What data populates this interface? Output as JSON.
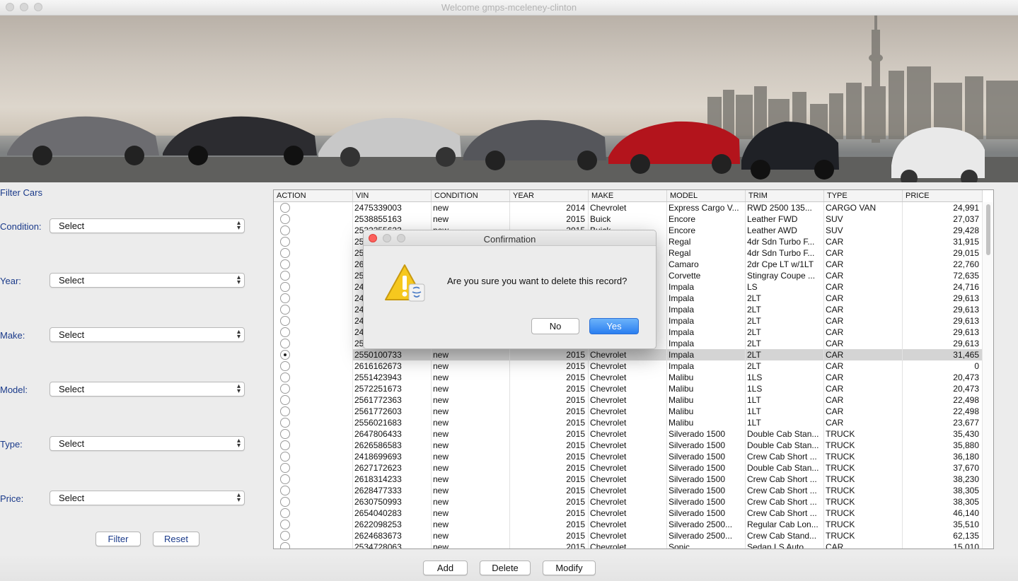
{
  "window": {
    "title": "Welcome gmps-mceleney-clinton"
  },
  "filter": {
    "title": "Filter Cars",
    "fields": [
      {
        "label": "Condition:",
        "value": "Select"
      },
      {
        "label": "Year:",
        "value": "Select"
      },
      {
        "label": "Make:",
        "value": "Select"
      },
      {
        "label": "Model:",
        "value": "Select"
      },
      {
        "label": "Type:",
        "value": "Select"
      },
      {
        "label": "Price:",
        "value": "Select"
      }
    ],
    "filter_button": "Filter",
    "reset_button": "Reset"
  },
  "table": {
    "columns": [
      "ACTION",
      "VIN",
      "CONDITION",
      "YEAR",
      "MAKE",
      "MODEL",
      "TRIM",
      "TYPE",
      "PRICE"
    ],
    "rows": [
      {
        "vin": "2475339003",
        "condition": "new",
        "year": "2014",
        "make": "Chevrolet",
        "model": "Express Cargo V...",
        "trim": "RWD 2500 135...",
        "type": "CARGO VAN",
        "price": "24,991",
        "selected": false
      },
      {
        "vin": "2538855163",
        "condition": "new",
        "year": "2015",
        "make": "Buick",
        "model": "Encore",
        "trim": "Leather FWD",
        "type": "SUV",
        "price": "27,037",
        "selected": false
      },
      {
        "vin": "2532355623",
        "condition": "new",
        "year": "2015",
        "make": "Buick",
        "model": "Encore",
        "trim": "Leather AWD",
        "type": "SUV",
        "price": "29,428",
        "selected": false
      },
      {
        "vin": "25",
        "condition": "",
        "year": "",
        "make": "",
        "model": "Regal",
        "trim": "4dr Sdn Turbo F...",
        "type": "CAR",
        "price": "31,915",
        "selected": false
      },
      {
        "vin": "25",
        "condition": "",
        "year": "",
        "make": "",
        "model": "Regal",
        "trim": "4dr Sdn Turbo F...",
        "type": "CAR",
        "price": "29,015",
        "selected": false
      },
      {
        "vin": "26",
        "condition": "",
        "year": "",
        "make": "",
        "model": "Camaro",
        "trim": "2dr Cpe LT w/1LT",
        "type": "CAR",
        "price": "22,760",
        "selected": false
      },
      {
        "vin": "25",
        "condition": "",
        "year": "",
        "make": "",
        "model": "Corvette",
        "trim": "Stingray Coupe ...",
        "type": "CAR",
        "price": "72,635",
        "selected": false
      },
      {
        "vin": "24",
        "condition": "",
        "year": "",
        "make": "",
        "model": "Impala",
        "trim": "LS",
        "type": "CAR",
        "price": "24,716",
        "selected": false
      },
      {
        "vin": "24",
        "condition": "",
        "year": "",
        "make": "",
        "model": "Impala",
        "trim": "2LT",
        "type": "CAR",
        "price": "29,613",
        "selected": false
      },
      {
        "vin": "24",
        "condition": "",
        "year": "",
        "make": "",
        "model": "Impala",
        "trim": "2LT",
        "type": "CAR",
        "price": "29,613",
        "selected": false
      },
      {
        "vin": "24",
        "condition": "",
        "year": "",
        "make": "",
        "model": "Impala",
        "trim": "2LT",
        "type": "CAR",
        "price": "29,613",
        "selected": false
      },
      {
        "vin": "24",
        "condition": "",
        "year": "",
        "make": "",
        "model": "Impala",
        "trim": "2LT",
        "type": "CAR",
        "price": "29,613",
        "selected": false
      },
      {
        "vin": "25",
        "condition": "",
        "year": "",
        "make": "",
        "model": "Impala",
        "trim": "2LT",
        "type": "CAR",
        "price": "29,613",
        "selected": false
      },
      {
        "vin": "2550100733",
        "condition": "new",
        "year": "2015",
        "make": "Chevrolet",
        "model": "Impala",
        "trim": "2LT",
        "type": "CAR",
        "price": "31,465",
        "selected": true
      },
      {
        "vin": "2616162673",
        "condition": "new",
        "year": "2015",
        "make": "Chevrolet",
        "model": "Impala",
        "trim": "2LT",
        "type": "CAR",
        "price": "0",
        "selected": false
      },
      {
        "vin": "2551423943",
        "condition": "new",
        "year": "2015",
        "make": "Chevrolet",
        "model": "Malibu",
        "trim": "1LS",
        "type": "CAR",
        "price": "20,473",
        "selected": false
      },
      {
        "vin": "2572251673",
        "condition": "new",
        "year": "2015",
        "make": "Chevrolet",
        "model": "Malibu",
        "trim": "1LS",
        "type": "CAR",
        "price": "20,473",
        "selected": false
      },
      {
        "vin": "2561772363",
        "condition": "new",
        "year": "2015",
        "make": "Chevrolet",
        "model": "Malibu",
        "trim": "1LT",
        "type": "CAR",
        "price": "22,498",
        "selected": false
      },
      {
        "vin": "2561772603",
        "condition": "new",
        "year": "2015",
        "make": "Chevrolet",
        "model": "Malibu",
        "trim": "1LT",
        "type": "CAR",
        "price": "22,498",
        "selected": false
      },
      {
        "vin": "2556021683",
        "condition": "new",
        "year": "2015",
        "make": "Chevrolet",
        "model": "Malibu",
        "trim": "1LT",
        "type": "CAR",
        "price": "23,677",
        "selected": false
      },
      {
        "vin": "2647806433",
        "condition": "new",
        "year": "2015",
        "make": "Chevrolet",
        "model": "Silverado 1500",
        "trim": "Double Cab Stan...",
        "type": "TRUCK",
        "price": "35,430",
        "selected": false
      },
      {
        "vin": "2626586583",
        "condition": "new",
        "year": "2015",
        "make": "Chevrolet",
        "model": "Silverado 1500",
        "trim": "Double Cab Stan...",
        "type": "TRUCK",
        "price": "35,880",
        "selected": false
      },
      {
        "vin": "2418699693",
        "condition": "new",
        "year": "2015",
        "make": "Chevrolet",
        "model": "Silverado 1500",
        "trim": "Crew Cab Short ...",
        "type": "TRUCK",
        "price": "36,180",
        "selected": false
      },
      {
        "vin": "2627172623",
        "condition": "new",
        "year": "2015",
        "make": "Chevrolet",
        "model": "Silverado 1500",
        "trim": "Double Cab Stan...",
        "type": "TRUCK",
        "price": "37,670",
        "selected": false
      },
      {
        "vin": "2618314233",
        "condition": "new",
        "year": "2015",
        "make": "Chevrolet",
        "model": "Silverado 1500",
        "trim": "Crew Cab Short ...",
        "type": "TRUCK",
        "price": "38,230",
        "selected": false
      },
      {
        "vin": "2628477333",
        "condition": "new",
        "year": "2015",
        "make": "Chevrolet",
        "model": "Silverado 1500",
        "trim": "Crew Cab Short ...",
        "type": "TRUCK",
        "price": "38,305",
        "selected": false
      },
      {
        "vin": "2630750993",
        "condition": "new",
        "year": "2015",
        "make": "Chevrolet",
        "model": "Silverado 1500",
        "trim": "Crew Cab Short ...",
        "type": "TRUCK",
        "price": "38,305",
        "selected": false
      },
      {
        "vin": "2654040283",
        "condition": "new",
        "year": "2015",
        "make": "Chevrolet",
        "model": "Silverado 1500",
        "trim": "Crew Cab Short ...",
        "type": "TRUCK",
        "price": "46,140",
        "selected": false
      },
      {
        "vin": "2622098253",
        "condition": "new",
        "year": "2015",
        "make": "Chevrolet",
        "model": "Silverado 2500...",
        "trim": "Regular Cab Lon...",
        "type": "TRUCK",
        "price": "35,510",
        "selected": false
      },
      {
        "vin": "2624683673",
        "condition": "new",
        "year": "2015",
        "make": "Chevrolet",
        "model": "Silverado 2500...",
        "trim": "Crew Cab Stand...",
        "type": "TRUCK",
        "price": "62,135",
        "selected": false
      },
      {
        "vin": "2534728063",
        "condition": "new",
        "year": "2015",
        "make": "Chevrolet",
        "model": "Sonic",
        "trim": "Sedan LS Auto",
        "type": "CAR",
        "price": "15,010",
        "selected": false
      }
    ]
  },
  "actions": {
    "add": "Add",
    "delete": "Delete",
    "modify": "Modify"
  },
  "dialog": {
    "title": "Confirmation",
    "message": "Are you sure you want to delete this record?",
    "no": "No",
    "yes": "Yes",
    "icon": "warning-icon"
  },
  "colors": {
    "accent": "#2a7ef0",
    "label_blue": "#1a3a8a",
    "close_red": "#fc605c"
  }
}
